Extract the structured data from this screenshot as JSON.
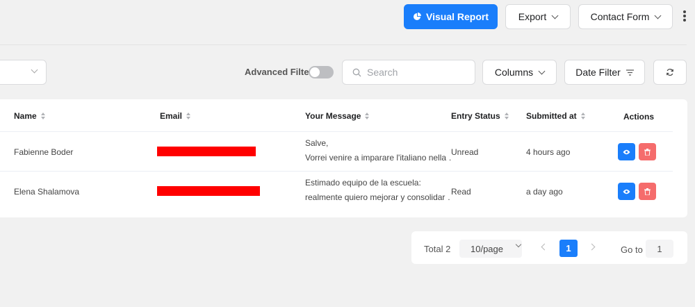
{
  "header": {
    "visual_report_label": "Visual Report",
    "export_label": "Export",
    "form_select_label": "Contact Form"
  },
  "filters": {
    "advanced_filter_label": "Advanced Filter",
    "advanced_filter_on": false,
    "search_placeholder": "Search",
    "columns_label": "Columns",
    "date_filter_label": "Date Filter"
  },
  "table": {
    "columns": [
      "Name",
      "Email",
      "Your Message",
      "Entry Status",
      "Submitted at",
      "Actions"
    ],
    "rows": [
      {
        "name": "Fabienne Boder",
        "message_line1": "Salve,",
        "message_line2": "Vorrei venire a imparare l'italiano nella …",
        "status": "Unread",
        "submitted": "4 hours ago"
      },
      {
        "name": "Elena Shalamova",
        "message_line1": "Estimado equipo de la escuela:",
        "message_line2": "realmente quiero mejorar y consolidar …",
        "status": "Read",
        "submitted": "a day ago"
      }
    ]
  },
  "pagination": {
    "total_label": "Total 2",
    "page_size_label": "10/page",
    "current_page": "1",
    "goto_label": "Go to",
    "goto_value": "1"
  },
  "colors": {
    "primary": "#1a7efb",
    "danger": "#f56c6c",
    "redaction": "#ff0000"
  }
}
